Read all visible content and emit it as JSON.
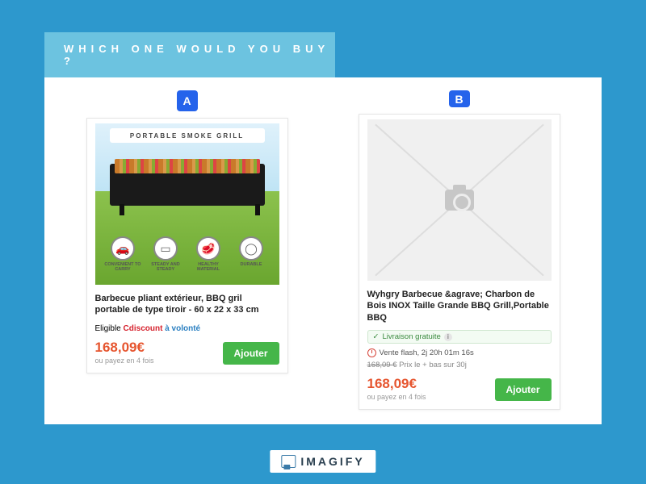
{
  "header": {
    "question": "WHICH ONE WOULD YOU BUY ?"
  },
  "badges": {
    "a": "A",
    "b": "B"
  },
  "cardA": {
    "img_banner": "PORTABLE SMOKE GRILL",
    "features": [
      {
        "icon": "🚗",
        "label": "CONVENIENT TO CARRY"
      },
      {
        "icon": "▭",
        "label": "STEADY AND STEADY"
      },
      {
        "icon": "🥩",
        "label": "HEALTHY MATERIAL"
      },
      {
        "icon": "◯",
        "label": "DURABLE"
      }
    ],
    "title": "Barbecue pliant extérieur, BBQ gril portable de type tiroir - 60 x 22 x 33 cm",
    "eligible_prefix": "Eligible ",
    "eligible_brand": "Cdiscount",
    "eligible_suffix": " à volonté",
    "price": "168,09€",
    "pay4": "ou payez en 4 fois",
    "button": "Ajouter"
  },
  "cardB": {
    "title": "Wyhgry Barbecue &agrave; Charbon de Bois INOX Taille Grande BBQ Grill,Portable BBQ",
    "shipping_label": "Livraison gratuite",
    "flash_label": "Vente flash, 2j 20h 01m 16s",
    "old_price": "168,09 €",
    "old_price_note": "Prix le + bas sur 30j",
    "price": "168,09€",
    "pay4": "ou payez en 4 fois",
    "button": "Ajouter"
  },
  "footer": {
    "brand": "IMAGIFY"
  }
}
